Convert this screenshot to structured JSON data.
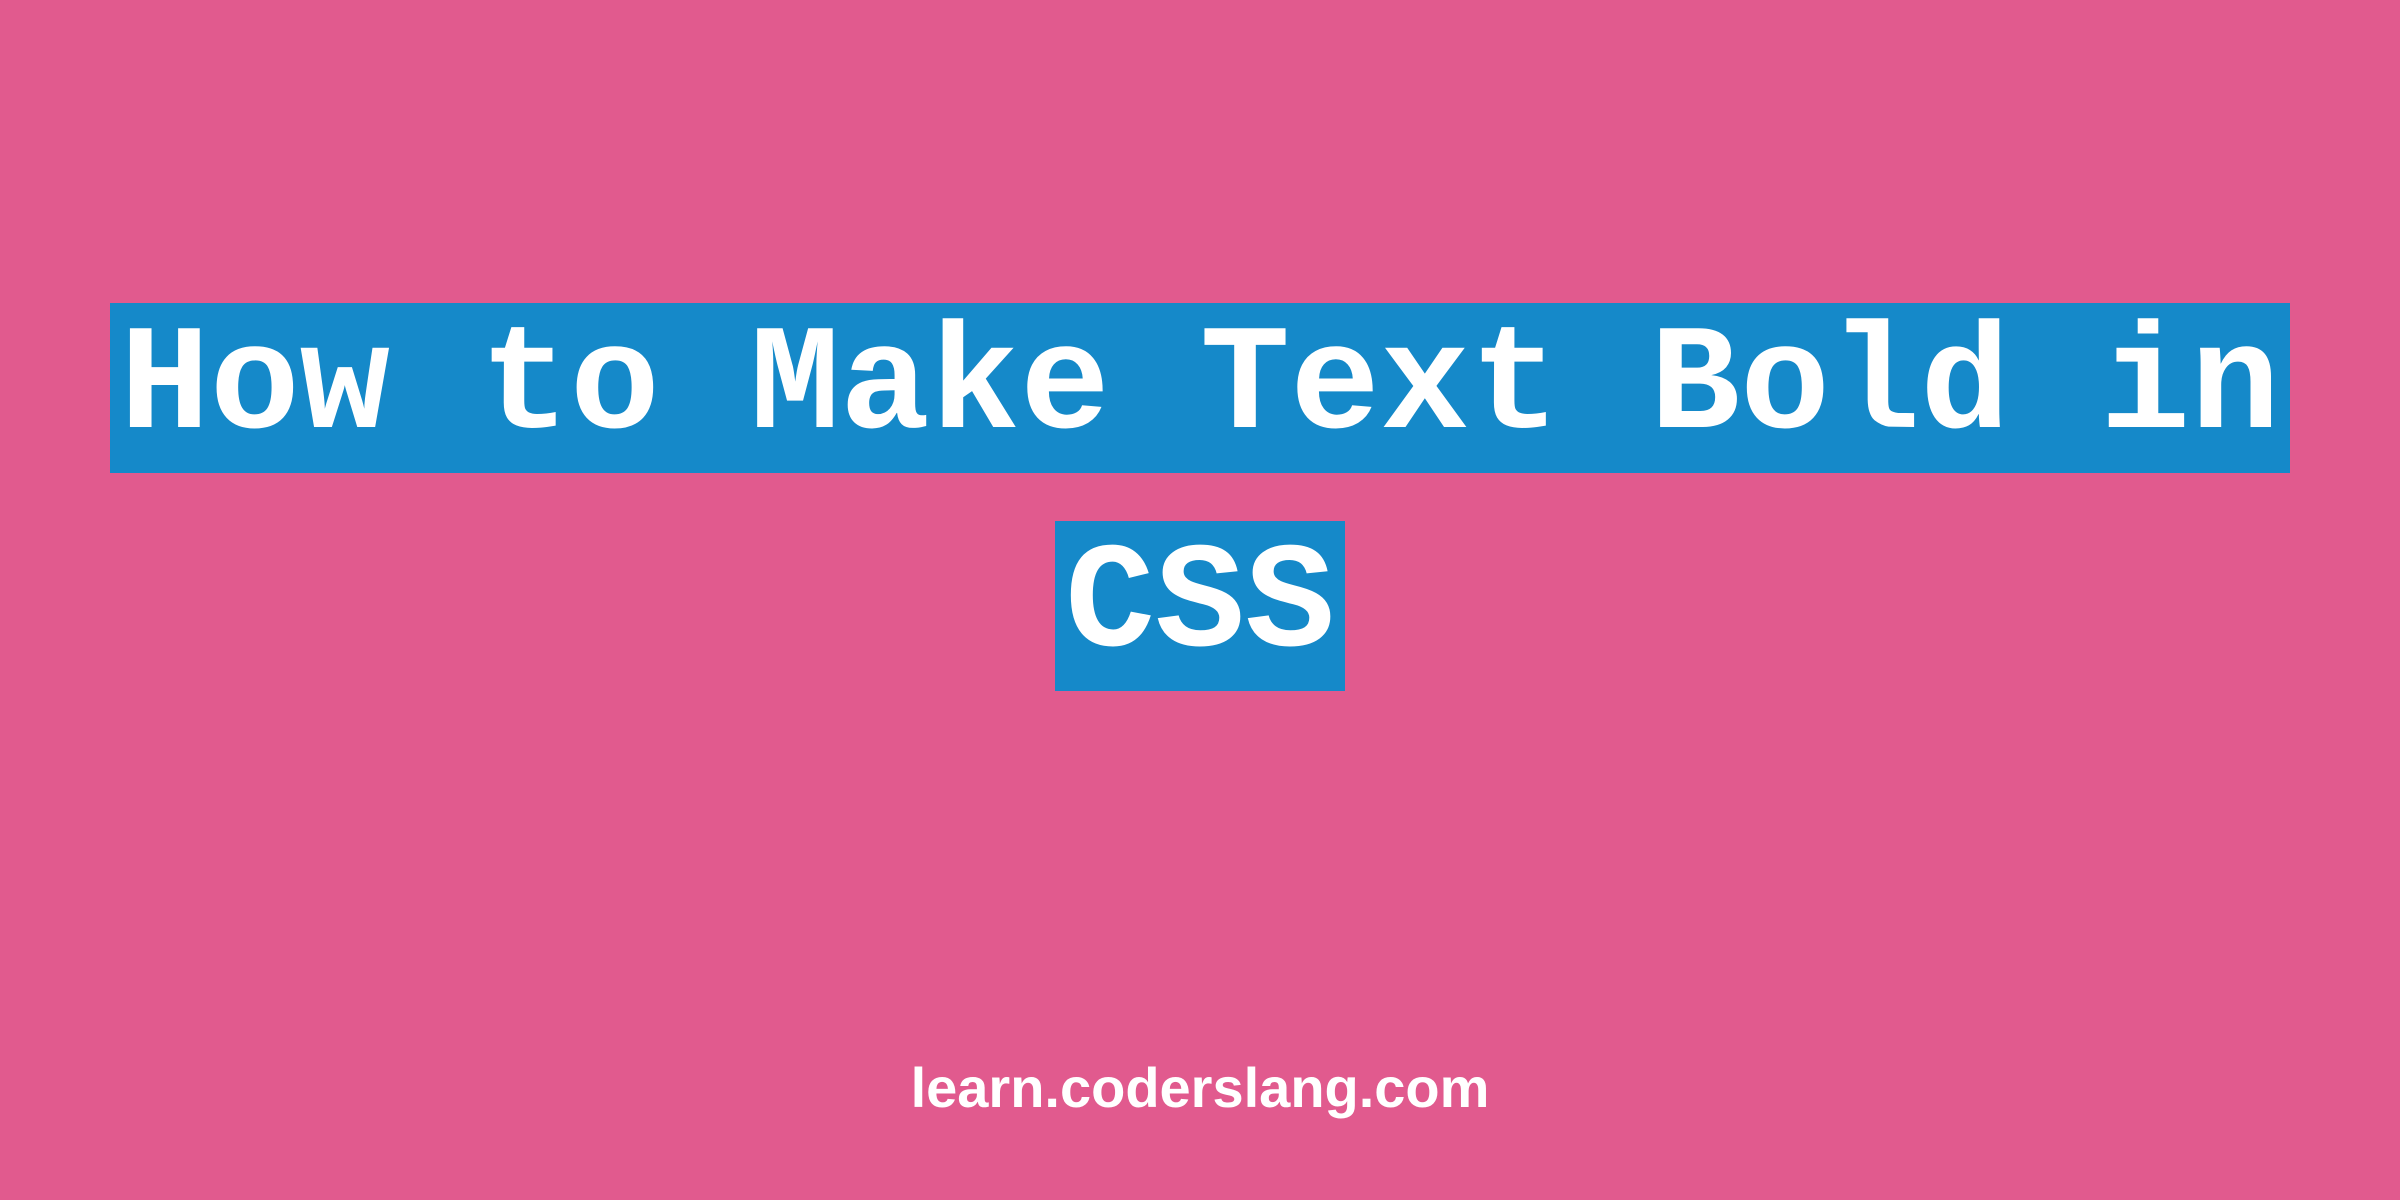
{
  "title": "How to Make Text Bold in CSS",
  "footer": "learn.coderslang.com",
  "colors": {
    "background": "#e15a8e",
    "highlight": "#1589c9",
    "text": "#ffffff"
  }
}
